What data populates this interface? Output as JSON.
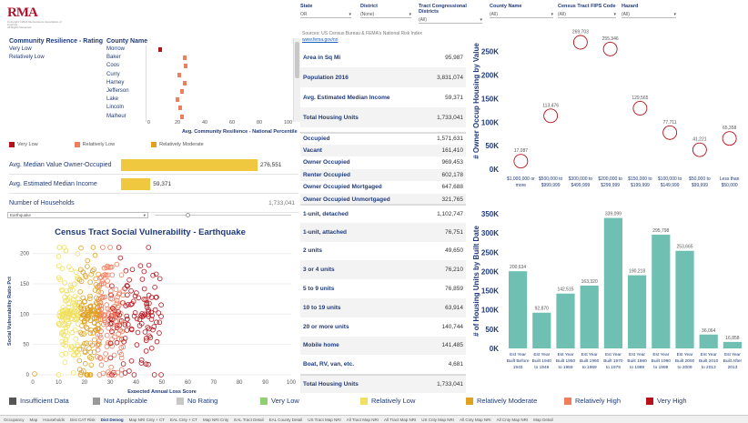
{
  "logo": {
    "mark": "RMA",
    "sub1": "Copyright ©2021 Reinsurance Association of America",
    "sub2": "All Rights Reserved"
  },
  "resilience": {
    "header_rating": "Community Resilience - Rating",
    "header_county": "County Name",
    "ratings": [
      "Very Low",
      "Relatively Low"
    ],
    "counties": [
      "Morrow",
      "Baker",
      "Coos",
      "Curry",
      "Harney",
      "Jefferson",
      "Lake",
      "Lincoln",
      "Malheur"
    ],
    "percentiles": [
      5,
      23,
      24,
      19,
      23,
      21,
      18,
      20,
      21
    ],
    "ticks": [
      "0",
      "20",
      "40",
      "60",
      "80",
      "100"
    ],
    "axis_label": "Avg. Community Resilience - National Percentile"
  },
  "legend_small": [
    {
      "label": "Very Low",
      "color": "#b5121b"
    },
    {
      "label": "Relatively Low",
      "color": "#f07d5c"
    },
    {
      "label": "Relatively Moderate",
      "color": "#e0a020"
    }
  ],
  "bars_left": [
    {
      "label": "Avg. Median Value Owner-Occupied",
      "value": "276,551",
      "frac": 1.0
    },
    {
      "label": "Avg. Estimated Median Income",
      "value": "59,371",
      "frac": 0.215
    },
    {
      "label": "Number of Households",
      "value": "1,733,041",
      "frac": 0
    }
  ],
  "hazard_select": "Earthquake",
  "scatter": {
    "title": "Census Tract Social Vulnerability - Earthquake",
    "xlabel": "Expected Annual Loss Score",
    "ylabel": "Social Vulnerability Ratio Pct",
    "xticks": [
      "0",
      "10",
      "20",
      "30",
      "40",
      "50",
      "60",
      "70",
      "80",
      "90",
      "100"
    ],
    "yticks": [
      "0",
      "50",
      "100",
      "150",
      "200"
    ]
  },
  "filters": [
    {
      "label": "State",
      "value": "OR"
    },
    {
      "label": "District",
      "value": "(None)"
    },
    {
      "label": "Tract Congressional Districts",
      "value": "(All)"
    },
    {
      "label": "County Name",
      "value": "(All)"
    },
    {
      "label": "Census Tract FIPS Code",
      "value": "(All)"
    },
    {
      "label": "Hazard",
      "value": "(All)"
    }
  ],
  "sources": "Sources: US Census Bureau & FEMA's National Risk Index",
  "sources_link": "www.fema.gov/nri",
  "stats": [
    {
      "label": "Area in Sq Mi",
      "value": "95,987"
    },
    {
      "label": "Population 2016",
      "value": "3,831,074"
    },
    {
      "label": "Avg. Estimated Median Income",
      "value": "59,371"
    },
    {
      "label": "Total Housing Units",
      "value": "1,733,041"
    }
  ],
  "occupancy": [
    {
      "label": "Occupied",
      "value": "1,571,631"
    },
    {
      "label": "Vacant",
      "value": "161,410"
    },
    {
      "label": "Owner Occupied",
      "value": "969,453"
    },
    {
      "label": "Renter Occupied",
      "value": "602,178"
    },
    {
      "label": "Owner Occupied Mortgaged",
      "value": "647,688"
    },
    {
      "label": "Owner Occupied Unmortgaged",
      "value": "321,765"
    }
  ],
  "units": [
    {
      "label": "1-unit, detached",
      "value": "1,102,747"
    },
    {
      "label": "1-unit, attached",
      "value": "76,751"
    },
    {
      "label": "2 units",
      "value": "49,650"
    },
    {
      "label": "3 or 4 units",
      "value": "76,210"
    },
    {
      "label": "5 to 9 units",
      "value": "76,859"
    },
    {
      "label": "10 to 19 units",
      "value": "63,914"
    },
    {
      "label": "20 or more units",
      "value": "140,744"
    },
    {
      "label": "Mobile home",
      "value": "141,485"
    },
    {
      "label": "Boat, RV, van, etc.",
      "value": "4,681"
    },
    {
      "label": "Total Housing Units",
      "value": "1,733,041"
    }
  ],
  "chart_data": [
    {
      "type": "scatter",
      "title": "",
      "ylabel": "# Owner Occup Housing by Value",
      "categories": [
        "$1,000,000 or more",
        "$500,000 to $999,999",
        "$300,000 to $499,999",
        "$200,000 to $299,999",
        "$150,000 to $199,999",
        "$100,000 to $149,999",
        "$50,000 to $99,999",
        "Less than $50,000"
      ],
      "values": [
        17087,
        113476,
        269703,
        255346,
        129565,
        77711,
        41221,
        65358
      ],
      "labels": [
        "17,087",
        "113,476",
        "269,703",
        "255,346",
        "129,565",
        "77,711",
        "41,221",
        "65,358"
      ],
      "ylim": [
        0,
        290000
      ],
      "yticks": [
        "0K",
        "50K",
        "100K",
        "150K",
        "200K",
        "250K"
      ]
    },
    {
      "type": "bar",
      "title": "",
      "ylabel": "# of Housing Units by Built Date",
      "categories": [
        "Est Year Built Before 1940",
        "Est Year Built 1940 to 1949",
        "Est Year Built 1950 to 1959",
        "Est Year Built 1960 to 1969",
        "Est Year Built 1970 to 1979",
        "Est Year Built 1980 to 1989",
        "Est Year Built 1990 to 1999",
        "Est Year Built 2000 to 2009",
        "Est Year Built 2010 to 2013",
        "Est Year Built After 2013"
      ],
      "values": [
        200634,
        92870,
        142515,
        163320,
        339099,
        190218,
        295798,
        253665,
        36064,
        16858
      ],
      "labels": [
        "200,634",
        "92,870",
        "142,515",
        "163,320",
        "339,099",
        "190,218",
        "295,798",
        "253,665",
        "36,064",
        "16,858"
      ],
      "ylim": [
        0,
        350000
      ],
      "yticks": [
        "0K",
        "50K",
        "100K",
        "150K",
        "200K",
        "250K",
        "300K",
        "350K"
      ],
      "color": "#6fbfb3"
    }
  ],
  "bottom_legend": [
    {
      "label": "Insufficient Data",
      "color": "#555555"
    },
    {
      "label": "Not Applicable",
      "color": "#999999"
    },
    {
      "label": "No Rating",
      "color": "#c8c8c8"
    },
    {
      "label": "Very Low",
      "color": "#90d070"
    },
    {
      "label": "Relatively Low",
      "color": "#f0e060"
    },
    {
      "label": "Relatively Moderate",
      "color": "#e0a020"
    },
    {
      "label": "Relatively High",
      "color": "#f07d5c"
    },
    {
      "label": "Very High",
      "color": "#b5121b"
    }
  ],
  "tabs": [
    "Occupancy",
    "Map",
    "Households",
    "Dist CAT Risk",
    "Dist Demog",
    "Map NRI Cnty + CT",
    "EAL Cnty + CT",
    "Map NRI Cnty",
    "EAL Tract Detail",
    "EAL County Detail",
    "US Tract Map NRI",
    "All Tract Map NRI",
    "All Tract Map NRI",
    "US Cnty Map NRI",
    "All Cnty Map NRI",
    "All Cnty Map NRI",
    "Map Detail"
  ],
  "active_tab": "Dist Demog"
}
